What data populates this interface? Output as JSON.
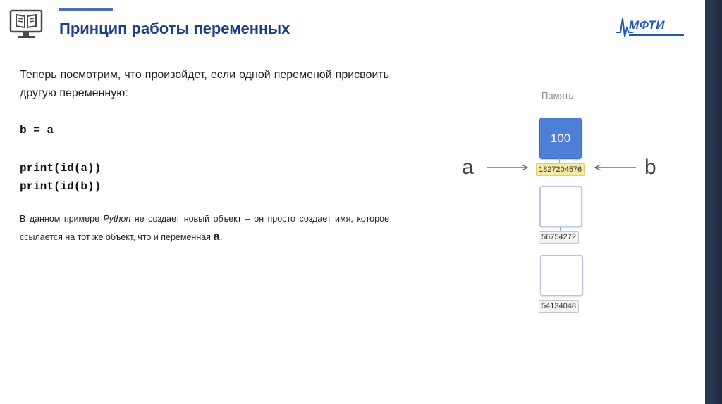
{
  "header": {
    "title": "Принцип работы переменных",
    "logo_text": "МФТИ"
  },
  "content": {
    "intro": "Теперь посмотрим, что произойдет, если одной переменой присвоить другую переменную:",
    "code_assign": "b = a",
    "code_print_a": "print(id(a))",
    "code_print_b": "print(id(b))",
    "note_part1": "В данном примере ",
    "note_python": "Python",
    "note_part2": " не создает новый объект – он просто создает имя, которое ссылается на тот же объект, что и переменная ",
    "note_var": "a",
    "note_end": "."
  },
  "memory": {
    "title": "Память",
    "cells": [
      {
        "value": "100",
        "address": "1827204576",
        "highlighted": true
      },
      {
        "value": "",
        "address": "56754272",
        "highlighted": false
      },
      {
        "value": "",
        "address": "54134048",
        "highlighted": false
      }
    ],
    "left_var": "a",
    "right_var": "b"
  },
  "colors": {
    "title": "#1f3f85",
    "filled_cell": "#4e7fd6",
    "address_highlight": "#f7e9a3"
  }
}
